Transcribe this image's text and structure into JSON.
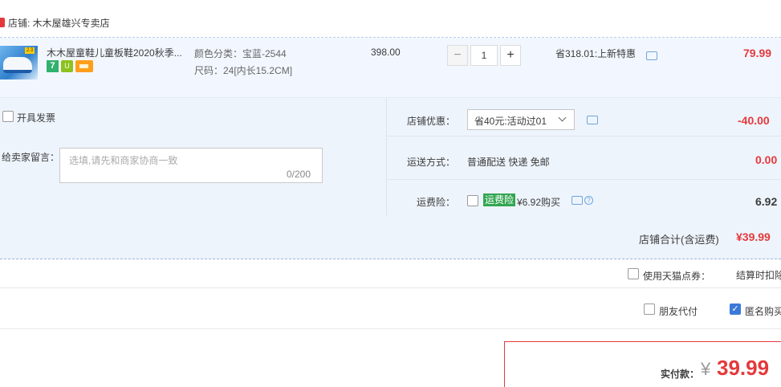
{
  "shop": {
    "label": "店铺: 木木屋雄兴专卖店"
  },
  "item": {
    "title": "木木屋童鞋儿童板鞋2020秋季...",
    "thumb_badge": "2.3",
    "badge_seven": "7",
    "badge_shield": "U",
    "sku_color": "颜色分类：宝蓝-2544",
    "sku_size": "尺码：24[内长15.2CM]",
    "unit_price": "398.00",
    "quantity": "1",
    "qty_minus": "−",
    "qty_plus": "+",
    "saved": "省318.01:上新特惠",
    "total": "79.99"
  },
  "options": {
    "invoice_label": "开具发票",
    "note_label": "给卖家留言：",
    "note_placeholder": "选填,请先和商家协商一致",
    "note_count": "0/200",
    "shop_discount_label": "店铺优惠：",
    "shop_discount_selected": "省40元:活动过01",
    "shop_discount_value": "-40.00",
    "shipping_label": "运送方式：",
    "shipping_value": "普通配送 快递 免邮",
    "shipping_cost": "0.00",
    "insurance_label": "运费险：",
    "insurance_tag": "运费险",
    "insurance_price": "¥6.92购买",
    "insurance_help": "?",
    "insurance_cost": "6.92"
  },
  "summary": {
    "label": "店铺合计(含运费)",
    "value": "¥39.99"
  },
  "coupon": {
    "label": "使用天猫点券：",
    "note": "结算时扣除"
  },
  "extras": {
    "friend_pay": "朋友代付",
    "anonymous": "匿名购买",
    "anonymous_checked": "✓"
  },
  "payment": {
    "label": "实付款：",
    "currency": "¥",
    "value": "39.99"
  },
  "colors": {
    "accent_red": "#e4393c",
    "item_bg": "#f2f7ff",
    "options_bg": "#eef4fc",
    "checkbox_blue": "#3b79d8",
    "insurance_green": "#32a651"
  }
}
